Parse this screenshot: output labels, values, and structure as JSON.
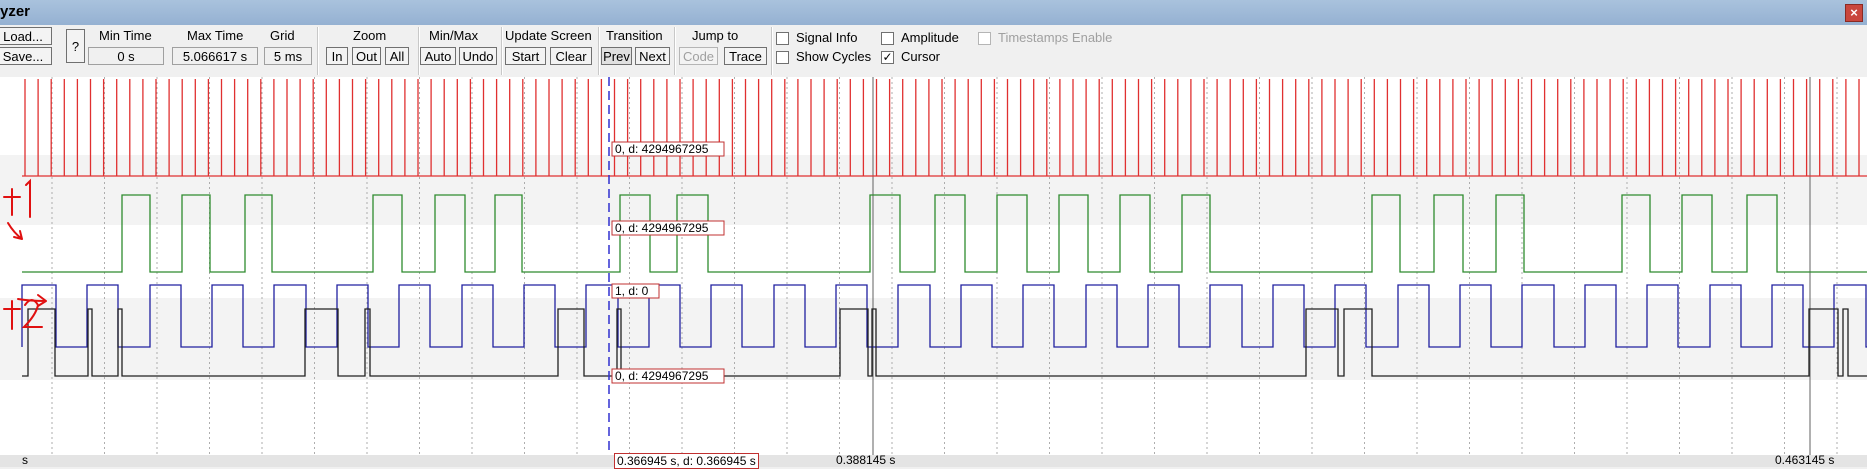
{
  "window": {
    "title": "yzer",
    "close_glyph": "×"
  },
  "toolbar": {
    "load_label": "Load...",
    "save_label": "Save...",
    "help_label": "?",
    "min_time": {
      "label": "Min Time",
      "value": "0 s"
    },
    "max_time": {
      "label": "Max Time",
      "value": "5.066617 s"
    },
    "grid": {
      "label": "Grid",
      "value": "5 ms"
    },
    "zoom": {
      "label": "Zoom",
      "buttons": [
        "In",
        "Out",
        "All"
      ]
    },
    "minmax": {
      "label": "Min/Max",
      "buttons": [
        "Auto",
        "Undo"
      ]
    },
    "update_screen": {
      "label": "Update Screen",
      "buttons": [
        "Start",
        "Clear"
      ]
    },
    "transition": {
      "label": "Transition",
      "buttons": [
        "Prev",
        "Next"
      ]
    },
    "jump_to": {
      "label": "Jump to",
      "buttons": [
        "Code",
        "Trace"
      ]
    },
    "checkboxes": [
      {
        "label": "Signal Info",
        "checked": false,
        "enabled": true
      },
      {
        "label": "Amplitude",
        "checked": false,
        "enabled": true
      },
      {
        "label": "Timestamps Enable",
        "checked": false,
        "enabled": false
      },
      {
        "label": "Show Cycles",
        "checked": false,
        "enabled": true
      },
      {
        "label": "Cursor",
        "checked": true,
        "enabled": true
      }
    ]
  },
  "signals": [
    {
      "color": "#e03030",
      "cursor_info": "0,  d: 4294967295"
    },
    {
      "color": "#2e8b2e",
      "cursor_info": "0,  d: 4294967295"
    },
    {
      "color": "#2020a0",
      "cursor_info": "1,  d: 0"
    },
    {
      "color": "#202020",
      "cursor_info": "0,  d: 4294967295"
    }
  ],
  "annotations": [
    "t1",
    "t2"
  ],
  "time_axis": {
    "left_label": "s",
    "cursor_label": "0.366945 s,  d: 0.366945 s",
    "mid_label": "0.388145 s",
    "right_label": "0.463145 s"
  },
  "colors": {
    "cursor": "#3030d0",
    "annotation": "#e01010",
    "grid": "#808080"
  }
}
